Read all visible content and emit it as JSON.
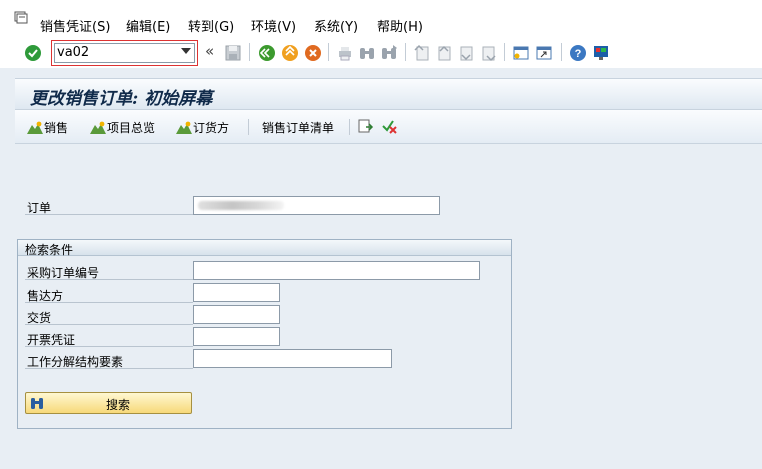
{
  "menu": {
    "items": [
      "销售凭证(S)",
      "编辑(E)",
      "转到(G)",
      "环境(V)",
      "系统(Y)",
      "帮助(H)"
    ]
  },
  "toolbar": {
    "command_value": "va02"
  },
  "title": "更改销售订单: 初始屏幕",
  "app_toolbar": {
    "sales": "销售",
    "item_overview": "项目总览",
    "ordering_party": "订货方",
    "sales_order_list": "销售订单清单"
  },
  "form": {
    "order_label": "订单",
    "order_value": ""
  },
  "search_criteria": {
    "title": "检索条件",
    "fields": [
      {
        "label": "采购订单编号",
        "value": ""
      },
      {
        "label": "售达方",
        "value": ""
      },
      {
        "label": "交货",
        "value": ""
      },
      {
        "label": "开票凭证",
        "value": ""
      },
      {
        "label": "工作分解结构要素",
        "value": ""
      }
    ],
    "search_button": "搜索"
  },
  "colors": {
    "accent_green": "#2e9a3a",
    "title_text": "#102a4a",
    "button_yellow": "#f7d97a"
  }
}
